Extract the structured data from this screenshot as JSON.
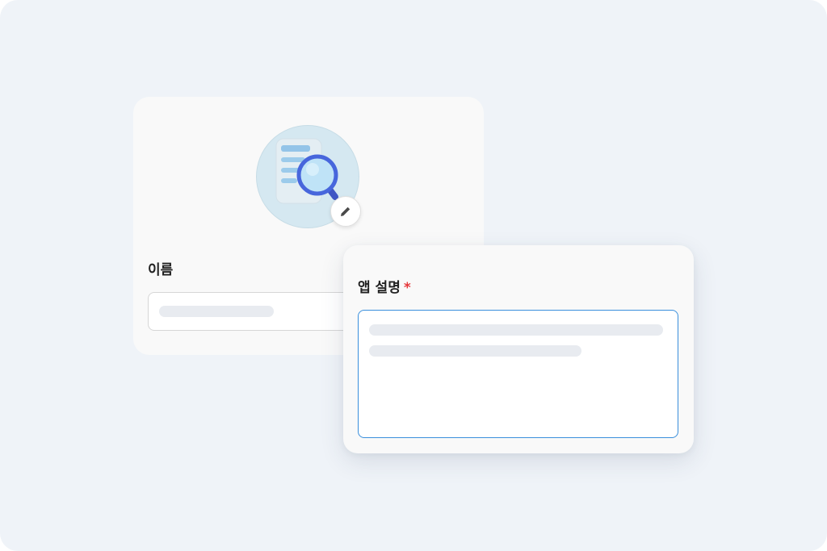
{
  "name_field": {
    "label": "이름",
    "placeholder": ""
  },
  "description_field": {
    "label": "앱 설명",
    "required_mark": "*",
    "placeholder": ""
  },
  "avatar": {
    "icon": "document-search-icon",
    "edit_icon": "pencil-icon"
  },
  "colors": {
    "background": "#eff3f8",
    "card": "#f9f9f9",
    "focus_border": "#3a8fdc",
    "required": "#e5383b",
    "skeleton": "#e8ebf0"
  }
}
